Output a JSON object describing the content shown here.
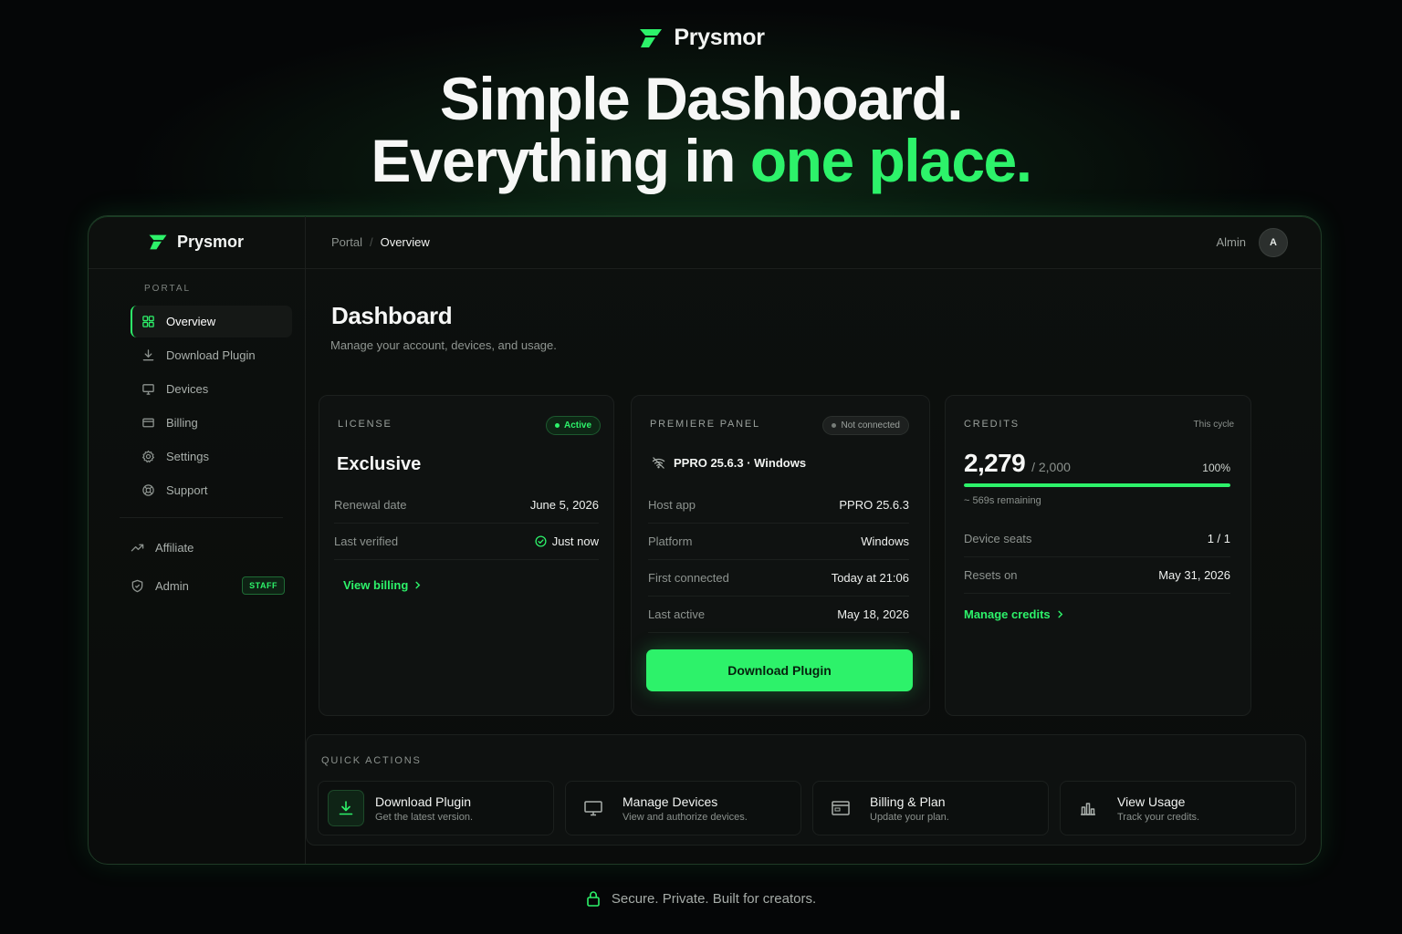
{
  "brand": {
    "name": "Prysmor",
    "accent_color": "#2df26a"
  },
  "hero": {
    "line1": "Simple Dashboard.",
    "line2_prefix": "Everything in ",
    "line2_accent": "one place."
  },
  "sidebar": {
    "brand": "Prysmor",
    "section_label": "PORTAL",
    "items": [
      {
        "label": "Overview",
        "icon": "grid-icon",
        "active": true
      },
      {
        "label": "Download Plugin",
        "icon": "download-icon"
      },
      {
        "label": "Devices",
        "icon": "monitor-icon"
      },
      {
        "label": "Billing",
        "icon": "card-icon"
      },
      {
        "label": "Settings",
        "icon": "gear-icon"
      },
      {
        "label": "Support",
        "icon": "lifebuoy-icon"
      }
    ],
    "secondary": [
      {
        "label": "Affiliate",
        "icon": "trending-icon"
      },
      {
        "label": "Admin",
        "icon": "shield-icon",
        "badge": "STAFF"
      }
    ]
  },
  "topbar": {
    "breadcrumb_root": "Portal",
    "breadcrumb_sep": "/",
    "breadcrumb_current": "Overview",
    "user_name": "Almin",
    "avatar_initial": "A"
  },
  "page": {
    "title": "Dashboard",
    "subtitle": "Manage your account, devices, and usage."
  },
  "license": {
    "label": "LICENSE",
    "status": "Active",
    "plan": "Exclusive",
    "rows": [
      {
        "key": "Renewal date",
        "value": "June 5, 2026"
      },
      {
        "key": "Last verified",
        "value": "Just now"
      }
    ],
    "link": "View billing"
  },
  "panel": {
    "label": "PREMIERE PANEL",
    "status": "Not connected",
    "device": "PPRO 25.6.3 · Windows",
    "rows": [
      {
        "key": "Host app",
        "value": "PPRO 25.6.3"
      },
      {
        "key": "Platform",
        "value": "Windows"
      },
      {
        "key": "First connected",
        "value": "Today at 21:06"
      },
      {
        "key": "Last active",
        "value": "May 18, 2026"
      }
    ],
    "button": "Download Plugin"
  },
  "credits": {
    "label": "CREDITS",
    "cycle": "This cycle",
    "used": "2,279",
    "total": "/ 2,000",
    "percent_label": "100%",
    "percent": 100,
    "remaining": "~ 569s remaining",
    "rows": [
      {
        "key": "Device seats",
        "value": "1 / 1"
      },
      {
        "key": "Resets on",
        "value": "May 31, 2026"
      }
    ],
    "link": "Manage credits"
  },
  "quick_actions": {
    "label": "QUICK ACTIONS",
    "items": [
      {
        "title": "Download Plugin",
        "desc": "Get the latest version.",
        "icon": "download-icon"
      },
      {
        "title": "Manage Devices",
        "desc": "View and authorize devices.",
        "icon": "monitor-icon"
      },
      {
        "title": "Billing & Plan",
        "desc": "Update your plan.",
        "icon": "card-icon"
      },
      {
        "title": "View Usage",
        "desc": "Track your credits.",
        "icon": "bar-chart-icon"
      }
    ]
  },
  "footer": {
    "text": "Secure. Private. Built for creators."
  }
}
